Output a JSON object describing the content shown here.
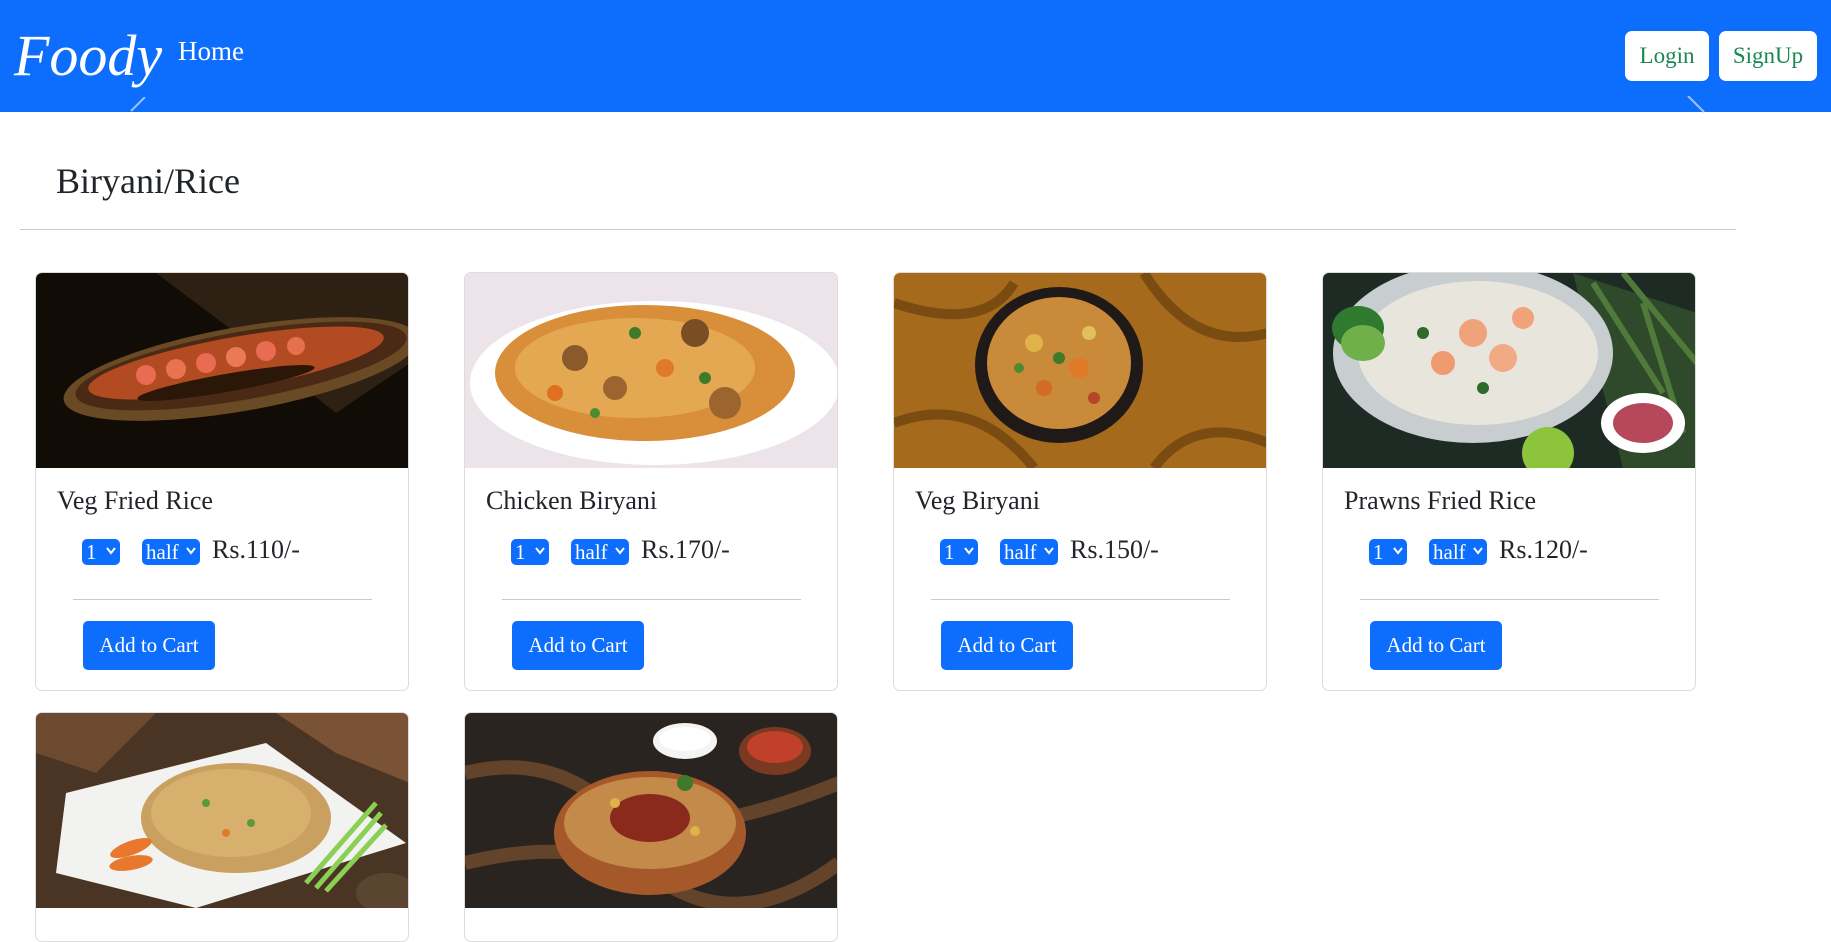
{
  "navbar": {
    "brand": "Foody",
    "home_label": "Home",
    "login_label": "Login",
    "signup_label": "SignUp",
    "background": "#0d6efd",
    "button_text_color": "#198754"
  },
  "section": {
    "title": "Biryani/Rice"
  },
  "cards": [
    {
      "title": "Veg Fried Rice",
      "qty": "1",
      "size": "half",
      "price": "Rs.110/-",
      "button": "Add to Cart"
    },
    {
      "title": "Chicken Biryani",
      "qty": "1",
      "size": "half",
      "price": "Rs.170/-",
      "button": "Add to Cart"
    },
    {
      "title": "Veg Biryani",
      "qty": "1",
      "size": "half",
      "price": "Rs.150/-",
      "button": "Add to Cart"
    },
    {
      "title": "Prawns Fried Rice",
      "qty": "1",
      "size": "half",
      "price": "Rs.120/-",
      "button": "Add to Cart"
    },
    {},
    {}
  ],
  "icons": {
    "select_arrow": "chevron-down-icon"
  }
}
